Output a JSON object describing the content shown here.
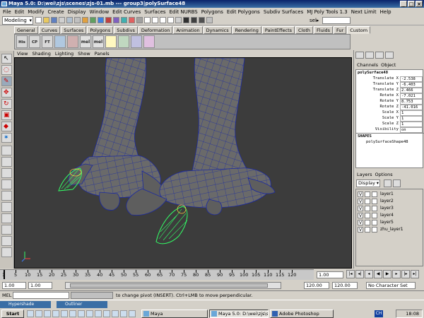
{
  "window": {
    "title": "Maya 5.0: D:\\wei\\zjs\\scenes\\zjs-01.mb   ---   group3|polySurface48",
    "controls": [
      "_",
      "□",
      "×"
    ]
  },
  "menubar": [
    "File",
    "Edit",
    "Modify",
    "Create",
    "Display",
    "Window",
    "Edit Curves",
    "Surfaces",
    "Edit NURBS",
    "Polygons",
    "Edit Polygons",
    "Subdiv Surfaces",
    "MJ Poly Tools 1.3",
    "Next Limit",
    "Help"
  ],
  "statusline": {
    "mode": "Modeling",
    "sel_label": "sel▸",
    "sel_value": ""
  },
  "shelf_tabs": [
    "General",
    "Curves",
    "Surfaces",
    "Polygons",
    "Subdivs",
    "Deformation",
    "Animation",
    "Dynamics",
    "Rendering",
    "PaintEffects",
    "Cloth",
    "Fluids",
    "Fur",
    "Custom"
  ],
  "shelf_active": "Custom",
  "shelf_icons": [
    "His",
    "CP",
    "FT",
    "mel",
    "mel"
  ],
  "panel_menu": [
    "View",
    "Shading",
    "Lighting",
    "Show",
    "Panels"
  ],
  "channel_box": {
    "menu": [
      "Channels",
      "Object"
    ],
    "object": "polySurface48",
    "channels": [
      {
        "label": "Translate X",
        "value": "-2.538"
      },
      {
        "label": "Translate Y",
        "value": "-6.403"
      },
      {
        "label": "Translate Z",
        "value": "2.466"
      },
      {
        "label": "Rotate X",
        "value": "-7.021"
      },
      {
        "label": "Rotate Y",
        "value": "8.753"
      },
      {
        "label": "Rotate Z",
        "value": "-41.016"
      },
      {
        "label": "Scale X",
        "value": "1"
      },
      {
        "label": "Scale Y",
        "value": "1"
      },
      {
        "label": "Scale Z",
        "value": "1"
      },
      {
        "label": "Visibility",
        "value": "on"
      }
    ],
    "shapes_label": "SHAPES",
    "shape_name": "polySurfaceShape48"
  },
  "layers": {
    "menu": [
      "Layers",
      "Options"
    ],
    "display": "Display",
    "items": [
      {
        "vis": "V",
        "name": "layer1"
      },
      {
        "vis": "V",
        "name": "layer2"
      },
      {
        "vis": "V",
        "name": "layer3"
      },
      {
        "vis": "V",
        "name": "layer4"
      },
      {
        "vis": "V",
        "name": "layer5"
      },
      {
        "vis": "V",
        "name": "zhu_layer1"
      }
    ]
  },
  "timeline": {
    "ticks": [
      "1",
      "5",
      "10",
      "15",
      "20",
      "25",
      "30",
      "35",
      "40",
      "45",
      "50",
      "55",
      "60",
      "65",
      "70",
      "75",
      "80",
      "85",
      "90",
      "95",
      "100",
      "105",
      "110",
      "115",
      "120"
    ],
    "current": "1.00"
  },
  "range": {
    "start": "1.00",
    "start2": "1.00",
    "end": "120.00",
    "end2": "120.00",
    "character_set": "No Character Set"
  },
  "command": {
    "label": "MEL",
    "help": "to change pivot (INSERT).  Ctrl+LMB to move perpendicular."
  },
  "taskbar": {
    "minimized": [
      "Hypershade",
      "Outliner"
    ],
    "start": "Start",
    "buttons": [
      "Maya",
      "Maya 5.0: D:\\wei\\zjs\\sce...",
      "Adobe Photoshop"
    ],
    "tray": "CH",
    "clock": "18:08"
  },
  "colors": {
    "viewport_bg": "#3c3c3c",
    "mesh": "#6a6a6a",
    "wire": "#1c2aa0",
    "selected": "#33ff66"
  }
}
